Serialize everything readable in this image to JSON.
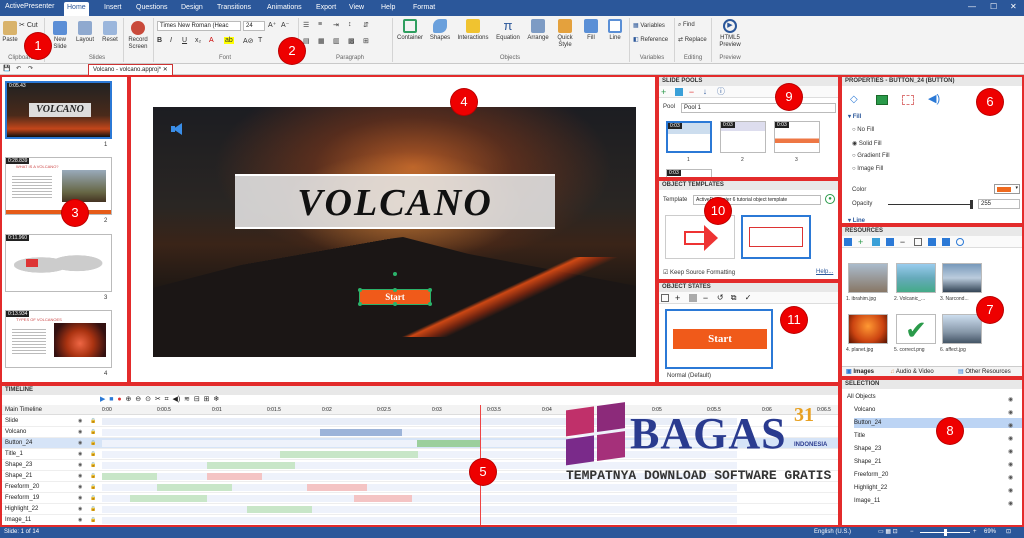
{
  "app": {
    "title": "ActivePresenter"
  },
  "menu": {
    "tabs": [
      "Home",
      "Insert",
      "Questions",
      "Design",
      "Transitions",
      "Animations",
      "Export",
      "View",
      "Help",
      "Format"
    ],
    "active": "Home"
  },
  "ribbon": {
    "clipboard": {
      "cut": "Cut",
      "paste": "Paste",
      "label": "Clipboard"
    },
    "slides": {
      "new_slide": "New Slide",
      "layout": "Layout",
      "reset": "Reset",
      "label": "Slides"
    },
    "record": {
      "label": "Record Screen"
    },
    "font": {
      "family": "Times New Roman (Heac",
      "size": "24",
      "label": "Font"
    },
    "paragraph": {
      "label": "Paragraph"
    },
    "objects": {
      "container": "Container",
      "shapes": "Shapes",
      "interactions": "Interactions",
      "equation": "Equation",
      "arrange": "Arrange",
      "quick_style": "Quick Style",
      "fill": "Fill",
      "line": "Line",
      "label": "Objects"
    },
    "variables": {
      "variables": "Variables",
      "reference": "Reference",
      "label": "Variables"
    },
    "editing": {
      "find": "Find",
      "replace": "Replace",
      "label": "Editing"
    },
    "preview": {
      "html5": "HTML5 Preview",
      "label": "Preview"
    }
  },
  "document": {
    "tab": "Volcano - volcano.approj*"
  },
  "slides_pane": {
    "slides": [
      {
        "time": "0:05.43",
        "num": "1",
        "title": "VOLCANO"
      },
      {
        "time": "0:28.839",
        "num": "2",
        "title": "WHAT IS A VOLCANO?"
      },
      {
        "time": "0:11.960",
        "num": "3",
        "title": ""
      },
      {
        "time": "0:13.934",
        "num": "4",
        "title": "TYPES OF VOLCANOES"
      }
    ]
  },
  "slide": {
    "title": "VOLCANO",
    "button": "Start"
  },
  "slide_pools": {
    "header": "SLIDE POOLS",
    "pool_label": "Pool",
    "pool_value": "Pool 1",
    "thumbs": [
      {
        "time": "0:03",
        "num": "1"
      },
      {
        "time": "0:03",
        "num": "2"
      },
      {
        "time": "0:03",
        "num": "3"
      },
      {
        "time": "0:03",
        "num": ""
      }
    ]
  },
  "object_templates": {
    "header": "OBJECT TEMPLATES",
    "template_label": "Template",
    "template_value": "ActivePresenter 6 tutorial object template",
    "keep_source": "Keep Source Formatting",
    "help": "Help..."
  },
  "object_states": {
    "header": "OBJECT STATES",
    "state_button": "Start",
    "state_name": "Normal (Default)"
  },
  "properties": {
    "header": "PROPERTIES - BUTTON_24 (BUTTON)",
    "fill_section": "Fill",
    "options": [
      "No Fill",
      "Solid Fill",
      "Gradient Fill",
      "Image Fill"
    ],
    "selected": "Solid Fill",
    "color_label": "Color",
    "opacity_label": "Opacity",
    "opacity_value": "255",
    "line_section": "Line",
    "fill_color": "#ef6a1f"
  },
  "resources": {
    "header": "RESOURCES",
    "items": [
      "1. ibrahim.jpg",
      "2. Volcanic_...",
      "3. Narcond...",
      "4. planet.jpg",
      "5. correct.png",
      "6. affect.jpg"
    ],
    "tabs": [
      "Images",
      "Audio & Video",
      "Other Resources"
    ]
  },
  "selection": {
    "header": "SELECTION",
    "items": [
      "All Objects",
      "Volcano",
      "Button_24",
      "Title",
      "Shape_23",
      "Shape_21",
      "Freeform_20",
      "Highlight_22",
      "Image_11"
    ]
  },
  "timeline": {
    "header": "TIMELINE",
    "main": "Main Timeline",
    "ticks": [
      "0:00",
      "0:00.5",
      "0:01",
      "0:01.5",
      "0:02",
      "0:02.5",
      "0:03",
      "0:03.5",
      "0:04",
      "0:04.5",
      "0:05",
      "0:05.5",
      "0:06",
      "0:06.5"
    ],
    "rows": [
      "Slide",
      "Volcano",
      "Button_24",
      "Title_1",
      "Shape_23",
      "Shape_21",
      "Freeform_20",
      "Freeform_19",
      "Highlight_22",
      "Image_11"
    ]
  },
  "status": {
    "slide": "Slide: 1 of 14",
    "lang": "English (U.S.)",
    "zoom": "69%"
  },
  "watermark": {
    "brand": "BAGAS",
    "number": "31",
    "sub": "INDONESIA",
    "tagline": "TEMPATNYA DOWNLOAD SOFTWARE GRATIS"
  },
  "callouts": [
    "1",
    "2",
    "3",
    "4",
    "5",
    "6",
    "7",
    "8",
    "9",
    "10",
    "11"
  ]
}
